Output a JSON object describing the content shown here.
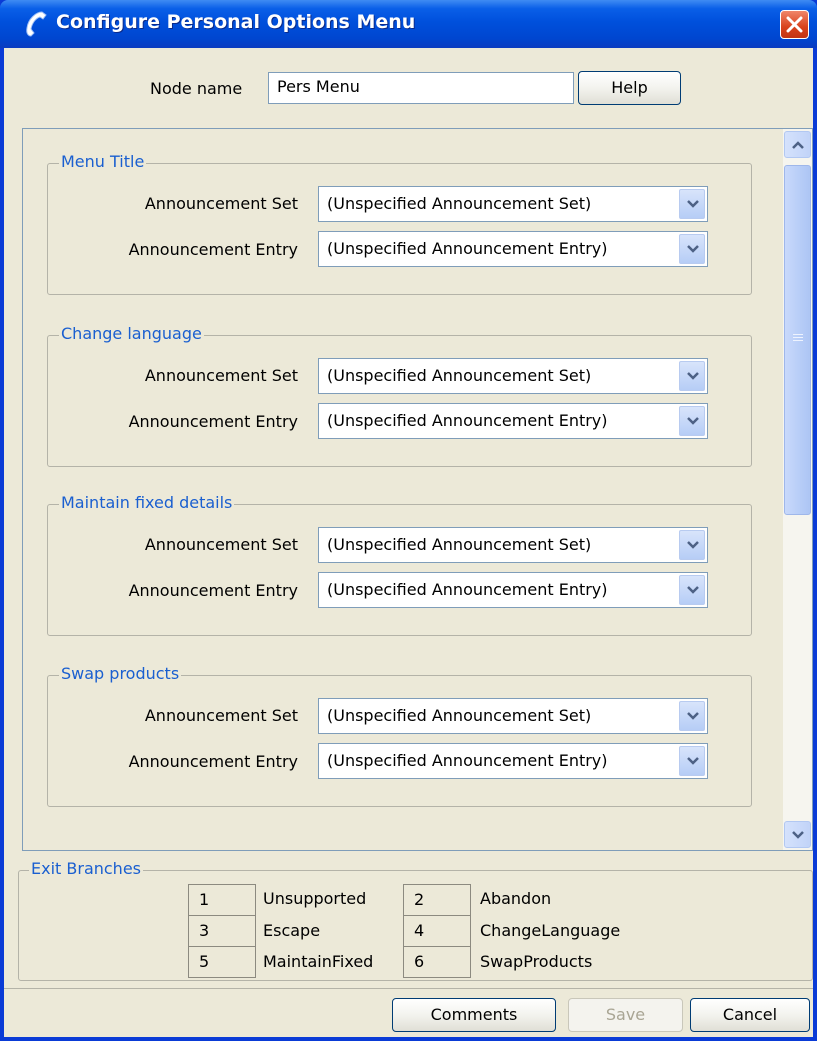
{
  "window": {
    "title": "Configure Personal Options Menu"
  },
  "node": {
    "label": "Node name",
    "value": "Pers Menu",
    "help_label": "Help"
  },
  "groups": [
    {
      "title": "Menu Title",
      "set_label": "Announcement Set",
      "set_value": "(Unspecified Announcement Set)",
      "entry_label": "Announcement Entry",
      "entry_value": "(Unspecified Announcement Entry)"
    },
    {
      "title": "Change language",
      "set_label": "Announcement Set",
      "set_value": "(Unspecified Announcement Set)",
      "entry_label": "Announcement Entry",
      "entry_value": "(Unspecified Announcement Entry)"
    },
    {
      "title": "Maintain fixed details",
      "set_label": "Announcement Set",
      "set_value": "(Unspecified Announcement Set)",
      "entry_label": "Announcement Entry",
      "entry_value": "(Unspecified Announcement Entry)"
    },
    {
      "title": "Swap products",
      "set_label": "Announcement Set",
      "set_value": "(Unspecified Announcement Set)",
      "entry_label": "Announcement Entry",
      "entry_value": "(Unspecified Announcement Entry)"
    }
  ],
  "exit_branches": {
    "title": "Exit Branches",
    "items": [
      {
        "num": "1",
        "name": "Unsupported"
      },
      {
        "num": "2",
        "name": "Abandon"
      },
      {
        "num": "3",
        "name": "Escape"
      },
      {
        "num": "4",
        "name": "ChangeLanguage"
      },
      {
        "num": "5",
        "name": "MaintainFixed"
      },
      {
        "num": "6",
        "name": "SwapProducts"
      }
    ]
  },
  "footer": {
    "comments_label": "Comments",
    "save_label": "Save",
    "cancel_label": "Cancel"
  },
  "icons": {
    "title": "phone-handset-icon",
    "close": "close-icon",
    "dropdown": "chevron-down-icon",
    "scroll_up": "scroll-up-icon",
    "scroll_down": "scroll-down-icon"
  },
  "colors": {
    "titlebar": "#0050dc",
    "close": "#d8421c",
    "group_title": "#1a5fd0",
    "panel": "#ece9d8"
  }
}
